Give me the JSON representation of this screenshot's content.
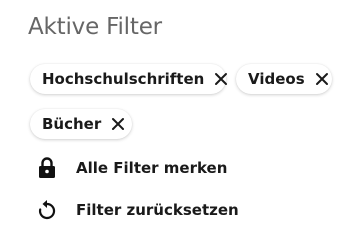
{
  "panel": {
    "title": "Aktive Filter"
  },
  "filters": [
    {
      "label": "Hochschulschriften",
      "remove_icon": "close-icon"
    },
    {
      "label": "Videos",
      "remove_icon": "close-icon"
    },
    {
      "label": "Bücher",
      "remove_icon": "close-icon"
    }
  ],
  "actions": {
    "save_filters": {
      "label": "Alle Filter merken",
      "icon": "lock-icon"
    },
    "reset_filters": {
      "label": "Filter zurücksetzen",
      "icon": "reset-icon"
    }
  },
  "colors": {
    "title": "#666666",
    "text": "#1a1a1a",
    "chip_background": "#ffffff"
  }
}
